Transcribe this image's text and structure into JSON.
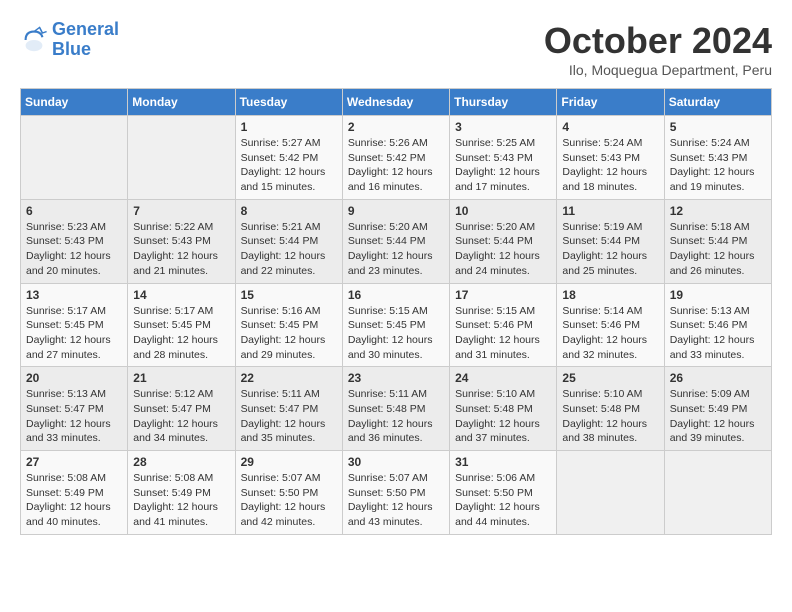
{
  "logo": {
    "line1": "General",
    "line2": "Blue"
  },
  "title": "October 2024",
  "subtitle": "Ilo, Moquegua Department, Peru",
  "weekdays": [
    "Sunday",
    "Monday",
    "Tuesday",
    "Wednesday",
    "Thursday",
    "Friday",
    "Saturday"
  ],
  "weeks": [
    [
      {
        "day": "",
        "info": ""
      },
      {
        "day": "",
        "info": ""
      },
      {
        "day": "1",
        "info": "Sunrise: 5:27 AM\nSunset: 5:42 PM\nDaylight: 12 hours and 15 minutes."
      },
      {
        "day": "2",
        "info": "Sunrise: 5:26 AM\nSunset: 5:42 PM\nDaylight: 12 hours and 16 minutes."
      },
      {
        "day": "3",
        "info": "Sunrise: 5:25 AM\nSunset: 5:43 PM\nDaylight: 12 hours and 17 minutes."
      },
      {
        "day": "4",
        "info": "Sunrise: 5:24 AM\nSunset: 5:43 PM\nDaylight: 12 hours and 18 minutes."
      },
      {
        "day": "5",
        "info": "Sunrise: 5:24 AM\nSunset: 5:43 PM\nDaylight: 12 hours and 19 minutes."
      }
    ],
    [
      {
        "day": "6",
        "info": "Sunrise: 5:23 AM\nSunset: 5:43 PM\nDaylight: 12 hours and 20 minutes."
      },
      {
        "day": "7",
        "info": "Sunrise: 5:22 AM\nSunset: 5:43 PM\nDaylight: 12 hours and 21 minutes."
      },
      {
        "day": "8",
        "info": "Sunrise: 5:21 AM\nSunset: 5:44 PM\nDaylight: 12 hours and 22 minutes."
      },
      {
        "day": "9",
        "info": "Sunrise: 5:20 AM\nSunset: 5:44 PM\nDaylight: 12 hours and 23 minutes."
      },
      {
        "day": "10",
        "info": "Sunrise: 5:20 AM\nSunset: 5:44 PM\nDaylight: 12 hours and 24 minutes."
      },
      {
        "day": "11",
        "info": "Sunrise: 5:19 AM\nSunset: 5:44 PM\nDaylight: 12 hours and 25 minutes."
      },
      {
        "day": "12",
        "info": "Sunrise: 5:18 AM\nSunset: 5:44 PM\nDaylight: 12 hours and 26 minutes."
      }
    ],
    [
      {
        "day": "13",
        "info": "Sunrise: 5:17 AM\nSunset: 5:45 PM\nDaylight: 12 hours and 27 minutes."
      },
      {
        "day": "14",
        "info": "Sunrise: 5:17 AM\nSunset: 5:45 PM\nDaylight: 12 hours and 28 minutes."
      },
      {
        "day": "15",
        "info": "Sunrise: 5:16 AM\nSunset: 5:45 PM\nDaylight: 12 hours and 29 minutes."
      },
      {
        "day": "16",
        "info": "Sunrise: 5:15 AM\nSunset: 5:45 PM\nDaylight: 12 hours and 30 minutes."
      },
      {
        "day": "17",
        "info": "Sunrise: 5:15 AM\nSunset: 5:46 PM\nDaylight: 12 hours and 31 minutes."
      },
      {
        "day": "18",
        "info": "Sunrise: 5:14 AM\nSunset: 5:46 PM\nDaylight: 12 hours and 32 minutes."
      },
      {
        "day": "19",
        "info": "Sunrise: 5:13 AM\nSunset: 5:46 PM\nDaylight: 12 hours and 33 minutes."
      }
    ],
    [
      {
        "day": "20",
        "info": "Sunrise: 5:13 AM\nSunset: 5:47 PM\nDaylight: 12 hours and 33 minutes."
      },
      {
        "day": "21",
        "info": "Sunrise: 5:12 AM\nSunset: 5:47 PM\nDaylight: 12 hours and 34 minutes."
      },
      {
        "day": "22",
        "info": "Sunrise: 5:11 AM\nSunset: 5:47 PM\nDaylight: 12 hours and 35 minutes."
      },
      {
        "day": "23",
        "info": "Sunrise: 5:11 AM\nSunset: 5:48 PM\nDaylight: 12 hours and 36 minutes."
      },
      {
        "day": "24",
        "info": "Sunrise: 5:10 AM\nSunset: 5:48 PM\nDaylight: 12 hours and 37 minutes."
      },
      {
        "day": "25",
        "info": "Sunrise: 5:10 AM\nSunset: 5:48 PM\nDaylight: 12 hours and 38 minutes."
      },
      {
        "day": "26",
        "info": "Sunrise: 5:09 AM\nSunset: 5:49 PM\nDaylight: 12 hours and 39 minutes."
      }
    ],
    [
      {
        "day": "27",
        "info": "Sunrise: 5:08 AM\nSunset: 5:49 PM\nDaylight: 12 hours and 40 minutes."
      },
      {
        "day": "28",
        "info": "Sunrise: 5:08 AM\nSunset: 5:49 PM\nDaylight: 12 hours and 41 minutes."
      },
      {
        "day": "29",
        "info": "Sunrise: 5:07 AM\nSunset: 5:50 PM\nDaylight: 12 hours and 42 minutes."
      },
      {
        "day": "30",
        "info": "Sunrise: 5:07 AM\nSunset: 5:50 PM\nDaylight: 12 hours and 43 minutes."
      },
      {
        "day": "31",
        "info": "Sunrise: 5:06 AM\nSunset: 5:50 PM\nDaylight: 12 hours and 44 minutes."
      },
      {
        "day": "",
        "info": ""
      },
      {
        "day": "",
        "info": ""
      }
    ]
  ]
}
